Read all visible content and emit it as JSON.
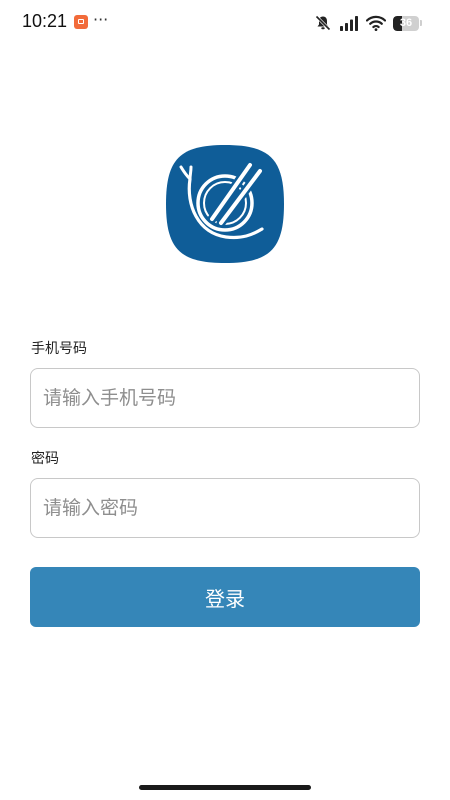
{
  "status_bar": {
    "time": "10:21",
    "more": "···",
    "battery_level": "36",
    "battery_percent": 36,
    "icons": [
      "app-notification-icon",
      "mute-icon",
      "signal-icon",
      "wifi-icon",
      "battery-icon"
    ]
  },
  "logo": {
    "icon": "bowl-chopsticks-logo-icon",
    "bg_color": "#0f5d98"
  },
  "form": {
    "phone_label": "手机号码",
    "phone_placeholder": "请输入手机号码",
    "phone_value": "",
    "password_label": "密码",
    "password_placeholder": "请输入密码",
    "password_value": "",
    "login_label": "登录"
  },
  "colors": {
    "accent": "#3586b8",
    "notification": "#f26b3a"
  }
}
